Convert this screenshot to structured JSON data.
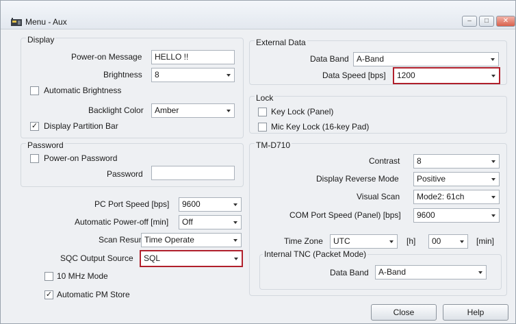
{
  "window": {
    "title": "Menu - Aux"
  },
  "display": {
    "title": "Display",
    "power_on_message_label": "Power-on Message",
    "power_on_message_value": "HELLO !!",
    "brightness_label": "Brightness",
    "brightness_value": "8",
    "auto_brightness_label": "Automatic Brightness",
    "auto_brightness_checked": false,
    "backlight_color_label": "Backlight Color",
    "backlight_color_value": "Amber",
    "partition_bar_label": "Display Partition Bar",
    "partition_bar_checked": true
  },
  "password": {
    "title": "Password",
    "power_on_password_label": "Power-on Password",
    "power_on_password_checked": false,
    "password_label": "Password",
    "password_value": ""
  },
  "misc": {
    "pc_port_speed_label": "PC Port Speed [bps]",
    "pc_port_speed_value": "9600",
    "auto_power_off_label": "Automatic Power-off [min]",
    "auto_power_off_value": "Off",
    "scan_resume_label": "Scan Resume",
    "scan_resume_value": "Time Operate",
    "sqc_output_label": "SQC Output Source",
    "sqc_output_value": "SQL",
    "mhz_mode_label": "10 MHz Mode",
    "mhz_mode_checked": false,
    "pm_store_label": "Automatic PM Store",
    "pm_store_checked": true
  },
  "external_data": {
    "title": "External Data",
    "data_band_label": "Data Band",
    "data_band_value": "A-Band",
    "data_speed_label": "Data Speed [bps]",
    "data_speed_value": "1200"
  },
  "lock": {
    "title": "Lock",
    "key_lock_label": "Key Lock (Panel)",
    "key_lock_checked": false,
    "mic_key_lock_label": "Mic Key Lock (16-key Pad)",
    "mic_key_lock_checked": false
  },
  "tmd710": {
    "title": "TM-D710",
    "contrast_label": "Contrast",
    "contrast_value": "8",
    "display_reverse_label": "Display Reverse Mode",
    "display_reverse_value": "Positive",
    "visual_scan_label": "Visual Scan",
    "visual_scan_value": "Mode2: 61ch",
    "com_port_label": "COM Port Speed (Panel) [bps]",
    "com_port_value": "9600",
    "time_zone_label": "Time Zone",
    "time_zone_value": "UTC",
    "hour_unit": "[h]",
    "minute_value": "00",
    "minute_unit": "[min]",
    "tnc_title": "Internal TNC (Packet Mode)",
    "tnc_data_band_label": "Data Band",
    "tnc_data_band_value": "A-Band"
  },
  "buttons": {
    "close": "Close",
    "help": "Help"
  },
  "colors": {
    "highlight": "#b01f2b"
  }
}
